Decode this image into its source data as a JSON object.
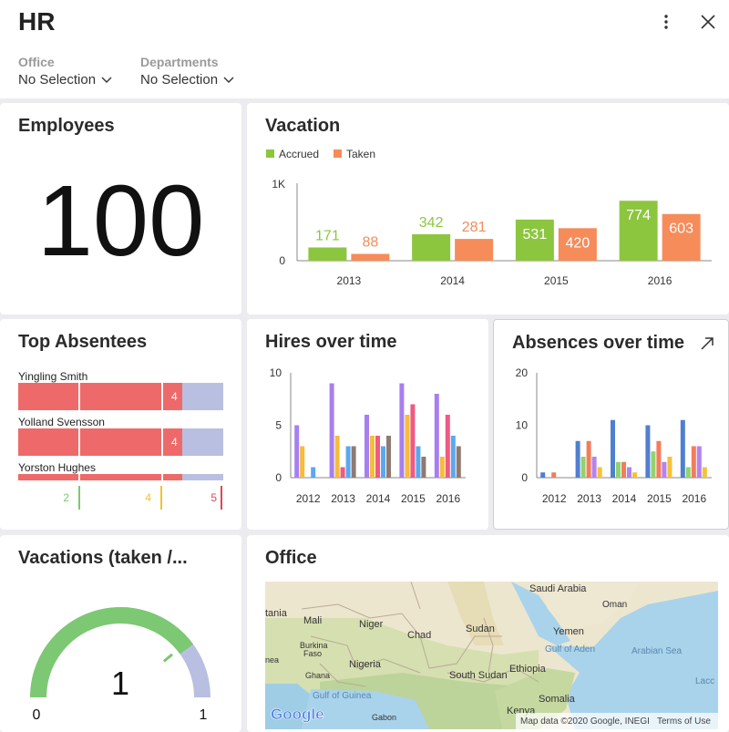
{
  "app": {
    "title": "HR"
  },
  "filters": [
    {
      "label": "Office",
      "value": "No Selection"
    },
    {
      "label": "Departments",
      "value": "No Selection"
    }
  ],
  "colors": {
    "accrued": "#8cc63f",
    "taken": "#f58c5a",
    "absentee_red": "#ee6a6a",
    "absentee_rest": "#b8bfe0",
    "gauge_green": "#7dc872",
    "gauge_rest": "#b8bfe0"
  },
  "cards": {
    "employees": {
      "title": "Employees",
      "value": "100"
    },
    "vacation": {
      "title": "Vacation"
    },
    "top_absentees": {
      "title": "Top Absentees",
      "people": [
        {
          "name": "Yingling Smith",
          "value": "4"
        },
        {
          "name": "Yolland Svensson",
          "value": "4"
        },
        {
          "name": "Yorston Hughes",
          "value": ""
        }
      ],
      "markers": [
        {
          "label": "2",
          "color": "#7dc872"
        },
        {
          "label": "4",
          "color": "#f2c12e"
        },
        {
          "label": "5",
          "color": "#e0484f"
        }
      ]
    },
    "hires": {
      "title": "Hires over time"
    },
    "absences": {
      "title": "Absences over time"
    },
    "vacations_ratio": {
      "title": "Vacations (taken /...",
      "value": "1",
      "min": "0",
      "max": "1",
      "fraction": 0.8
    },
    "office": {
      "title": "Office",
      "map_labels": [
        "Saudi Arabia",
        "Oman",
        "tania",
        "Mali",
        "Niger",
        "Sudan",
        "Chad",
        "Yemen",
        "Burkina",
        "Faso",
        "Gulf of Aden",
        "Arabian Sea",
        "nea",
        "Nigeria",
        "Ethiopia",
        "Ghana",
        "South Sudan",
        "Gulf of Guinea",
        "Somalia",
        "Kenya",
        "Gabon",
        "Lacc"
      ],
      "google_logo": "Google",
      "attribution": "Map data ©2020 Google, INEGI",
      "terms": "Terms of Use"
    }
  },
  "chart_data": [
    {
      "type": "bar",
      "title": "Vacation",
      "categories": [
        "2013",
        "2014",
        "2015",
        "2016"
      ],
      "series": [
        {
          "name": "Accrued",
          "values": [
            171,
            342,
            531,
            774
          ]
        },
        {
          "name": "Taken",
          "values": [
            88,
            281,
            420,
            603
          ]
        }
      ],
      "ylim": [
        0,
        1000
      ],
      "ytick_labels": [
        "0",
        "1K"
      ],
      "legend": "top-left"
    },
    {
      "type": "bar",
      "title": "Hires over time",
      "categories": [
        "2012",
        "2013",
        "2014",
        "2015",
        "2016"
      ],
      "series": [
        {
          "values": [
            5,
            9,
            6,
            9,
            8
          ]
        },
        {
          "values": [
            3,
            4,
            4,
            6,
            2
          ]
        },
        {
          "values": [
            0,
            1,
            4,
            7,
            6
          ]
        },
        {
          "values": [
            1,
            3,
            3,
            3,
            4
          ]
        },
        {
          "values": [
            0,
            3,
            4,
            2,
            3
          ]
        }
      ],
      "series_colors": [
        "#a77ff0",
        "#f5bd3a",
        "#ef5a82",
        "#5aa8f0",
        "#8f7a72"
      ],
      "ylim": [
        0,
        10
      ],
      "yticks": [
        0,
        5,
        10
      ]
    },
    {
      "type": "bar",
      "title": "Absences over time",
      "categories": [
        "2012",
        "2013",
        "2014",
        "2015",
        "2016"
      ],
      "series": [
        {
          "values": [
            1,
            7,
            11,
            10,
            11
          ]
        },
        {
          "values": [
            0,
            4,
            3,
            5,
            2
          ]
        },
        {
          "values": [
            1,
            7,
            3,
            7,
            6
          ]
        },
        {
          "values": [
            0,
            4,
            2,
            3,
            6
          ]
        },
        {
          "values": [
            0,
            2,
            1,
            4,
            2
          ]
        }
      ],
      "series_colors": [
        "#4f7fd0",
        "#92d36e",
        "#f47c5a",
        "#b582f0",
        "#f5c138"
      ],
      "ylim": [
        0,
        20
      ],
      "yticks": [
        0,
        10,
        20
      ]
    }
  ]
}
